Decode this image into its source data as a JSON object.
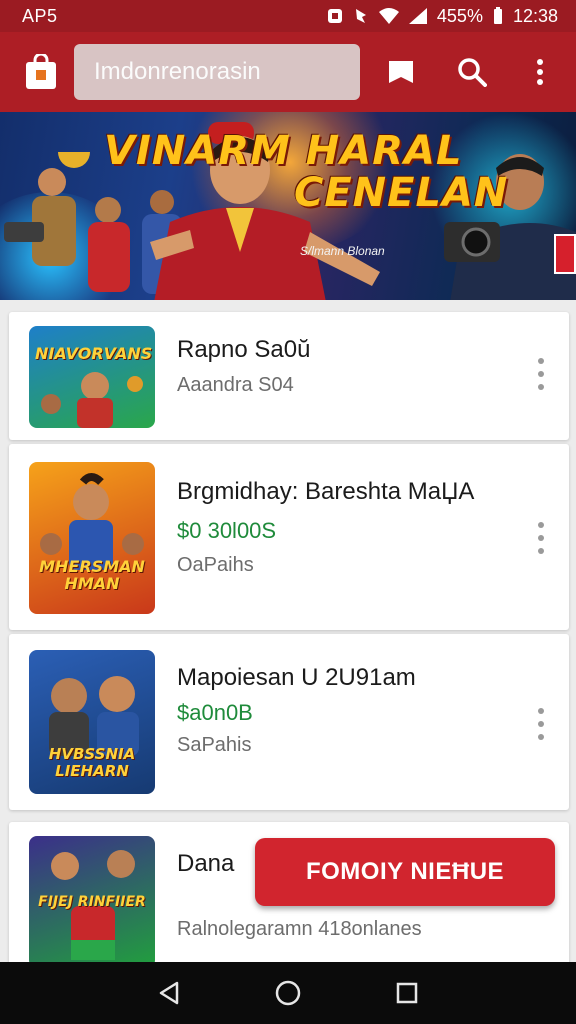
{
  "status_bar": {
    "left_text": "AP5",
    "battery": "455%",
    "time": "12:38"
  },
  "app_bar": {
    "search_text": "Imdonrenorasin",
    "icons": [
      "store-bag-icon",
      "bookmark-icon",
      "search-icon",
      "more-vert-icon"
    ]
  },
  "banner": {
    "title_line1": "VINARM HARAL",
    "title_line2": "CENELAN",
    "subtitle": "S/lmann Blonan"
  },
  "items": [
    {
      "title": "Rapno Sa0ŭ",
      "price": "",
      "subtitle": "Aaandra S04",
      "thumb_text": "NIAVORVANS",
      "thumb_colors": [
        "#1e7fc9",
        "#2aa74a"
      ]
    },
    {
      "title": "Brgmidhay: Bareshta MaЏA",
      "price": "$0 30l00S",
      "subtitle": "OaPaihs",
      "thumb_text": "MHERSMAN HMAN",
      "thumb_colors": [
        "#f6a21a",
        "#c9381a"
      ]
    },
    {
      "title": "Mapoiesan U 2U91am",
      "price": "$a0n0B",
      "subtitle": "SaPahis",
      "thumb_text": "HVBSSNIA LIEHARN",
      "thumb_colors": [
        "#2b5fb5",
        "#163a72"
      ]
    },
    {
      "title": "Dana",
      "price": "",
      "subtitle": "Ralnolegaramn   418onlanes",
      "thumb_text": "FIJEJ RINFIIER",
      "thumb_colors": [
        "#3b2f8a",
        "#21a03d"
      ]
    }
  ],
  "fab": {
    "label": "FOMOIY NIEĦUE"
  },
  "colors": {
    "primary": "#ad1e25",
    "status": "#9b1b22",
    "price_green": "#1f8b3b",
    "fab": "#d1252e"
  }
}
